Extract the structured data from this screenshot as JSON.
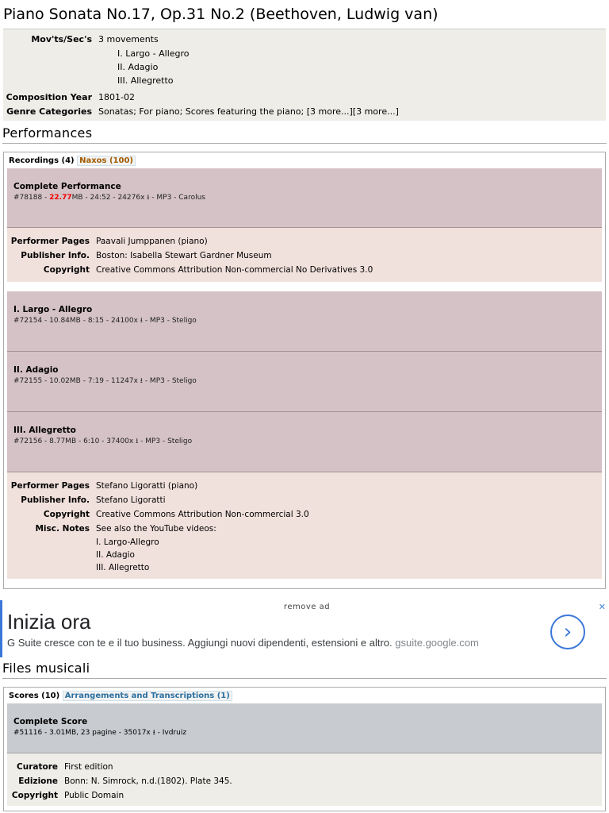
{
  "page_title": "Piano Sonata No.17, Op.31 No.2 (Beethoven, Ludwig van)",
  "info": {
    "movements_label": "Mov'ts/Sec's",
    "movements_value": "3 movements",
    "movements": [
      "I. Largo - Allegro",
      "II. Adagio",
      "III. Allegretto"
    ],
    "year_label": "Composition Year",
    "year_value": "1801-02",
    "genre_label": "Genre Categories",
    "genre_value": "Sonatas; For piano; Scores featuring the piano; [3 more...][3 more...]"
  },
  "performances": {
    "heading": "Performances",
    "tab_recordings": "Recordings (4)",
    "tab_naxos": "Naxos (100)",
    "rec1": {
      "title": "Complete Performance",
      "id": "#78188",
      "size": "22.77",
      "meta_rest": "MB - 24:52 - 24276x ⭳ - MP3 - Carolus"
    },
    "det1": {
      "performer_label": "Performer Pages",
      "performer": "Paavali Jumppanen (piano)",
      "publisher_label": "Publisher Info.",
      "publisher": "Boston: Isabella Stewart Gardner Museum",
      "copyright_label": "Copyright",
      "copyright": "Creative Commons Attribution Non-commercial No Derivatives 3.0"
    },
    "rec2": {
      "title": "I. Largo - Allegro",
      "meta": "#72154 - 10.84MB - 8:15 - 24100x ⭳ - MP3 - Steligo"
    },
    "rec3": {
      "title": "II. Adagio",
      "meta": "#72155 - 10.02MB - 7:19 - 11247x ⭳ - MP3 - Steligo"
    },
    "rec4": {
      "title": "III. Allegretto",
      "meta": "#72156 - 8.77MB - 6:10 - 37400x ⭳ - MP3 - Steligo"
    },
    "det2": {
      "performer_label": "Performer Pages",
      "performer": "Stefano Ligoratti (piano)",
      "publisher_label": "Publisher Info.",
      "publisher": "Stefano Ligoratti",
      "copyright_label": "Copyright",
      "copyright": "Creative Commons Attribution Non-commercial 3.0",
      "notes_label": "Misc. Notes",
      "notes": "See also the YouTube videos:",
      "notes_items": [
        "I. Largo-Allegro",
        "II. Adagio",
        "III. Allegretto"
      ]
    }
  },
  "ad": {
    "remove": "remove ad",
    "headline": "Inizia ora",
    "text": "G Suite cresce con te e il tuo business. Aggiungi nuovi dipendenti, estensioni e altro.",
    "url": "gsuite.google.com",
    "close": "✕",
    "arrow": "›"
  },
  "files": {
    "heading": "Files musicali",
    "tab_scores": "Scores (10)",
    "tab_arr": "Arrangements and Transcriptions (1)",
    "score1": {
      "title": "Complete Score",
      "meta": "#51116 - 3.01MB, 23 pagine - 35017x ⭳ - Ivdruiz"
    },
    "det": {
      "curator_label": "Curatore",
      "curator": "First edition",
      "edition_label": "Edizione",
      "edition": "Bonn: N. Simrock, n.d.(1802). Plate 345.",
      "copyright_label": "Copyright",
      "copyright": "Public Domain"
    }
  }
}
